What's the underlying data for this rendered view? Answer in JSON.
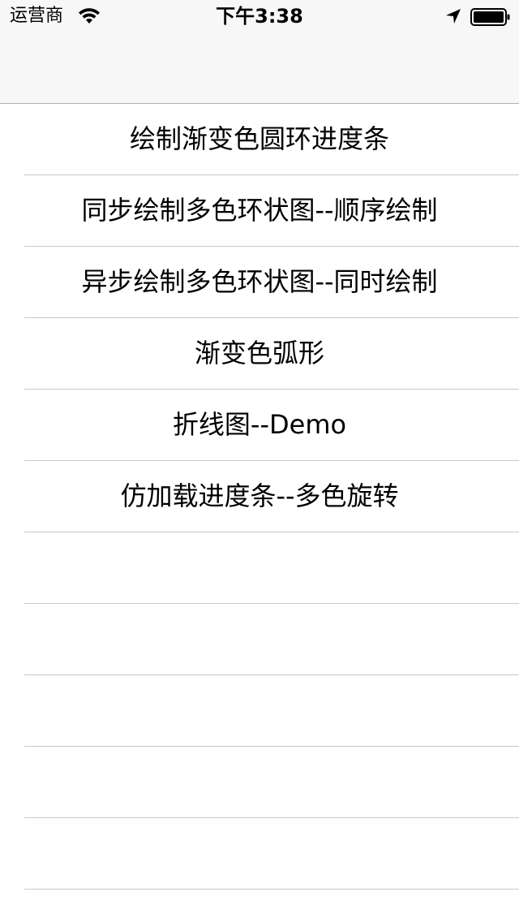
{
  "status_bar": {
    "carrier": "运营商",
    "time": "下午3:38",
    "wifi_icon": "wifi-icon",
    "location_icon": "location-arrow-icon",
    "battery_icon": "battery-icon"
  },
  "table": {
    "rows": [
      {
        "label": "绘制渐变色圆环进度条"
      },
      {
        "label": "同步绘制多色环状图--顺序绘制"
      },
      {
        "label": "异步绘制多色环状图--同时绘制"
      },
      {
        "label": "渐变色弧形"
      },
      {
        "label": "折线图--Demo"
      },
      {
        "label": "仿加载进度条--多色旋转"
      },
      {
        "label": ""
      },
      {
        "label": ""
      },
      {
        "label": ""
      },
      {
        "label": ""
      },
      {
        "label": ""
      }
    ]
  },
  "colors": {
    "nav_background": "#f7f7f7",
    "separator": "#c8c7cc",
    "text": "#000000"
  }
}
